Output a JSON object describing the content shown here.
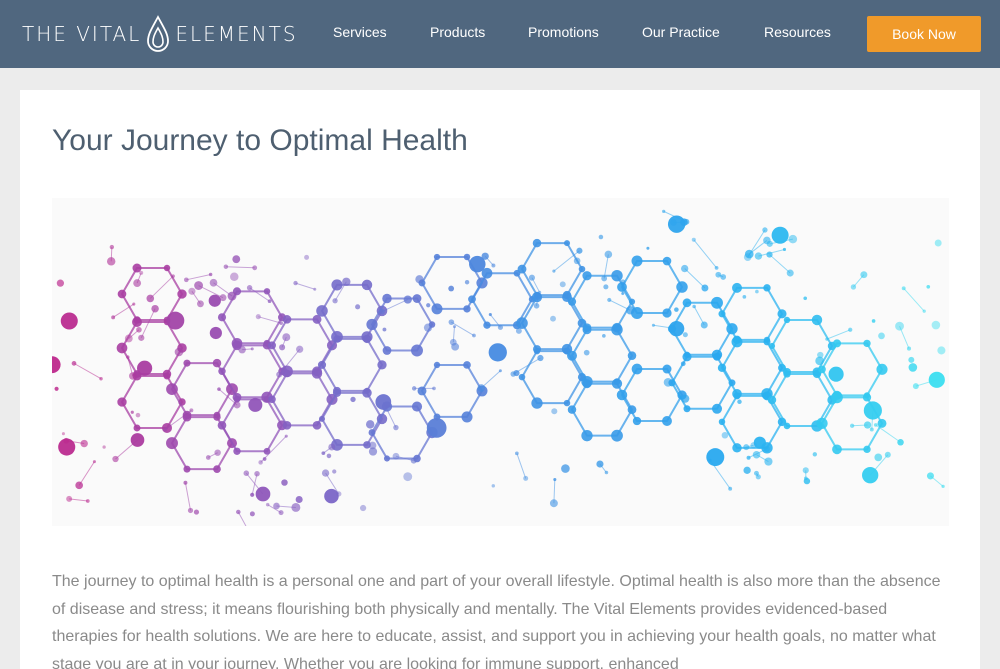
{
  "brand": {
    "name_left": "THE VITAL",
    "name_right": "ELEMENTS"
  },
  "nav": {
    "items": [
      {
        "label": "Services"
      },
      {
        "label": "Products"
      },
      {
        "label": "Promotions"
      },
      {
        "label": "Our Practice"
      },
      {
        "label": "Resources"
      }
    ],
    "cta_label": "Book Now"
  },
  "colors": {
    "header_bg": "#50677f",
    "cta_bg": "#f09a2a",
    "title": "#4e5f70",
    "body_text": "#8a8a8a"
  },
  "main": {
    "title": "Your Journey to Optimal Health",
    "hero_icon": "molecular-network-illustration",
    "paragraph": "The journey to optimal health is a personal one and part of your overall lifestyle. Optimal health is also more than the absence of disease and stress; it means flourishing both physically and mentally. The Vital Elements provides evidenced-based therapies for health solutions. We are here to educate, assist, and support you in achieving your health goals, no matter what stage you are at in your journey. Whether you are looking for immune support, enhanced"
  }
}
